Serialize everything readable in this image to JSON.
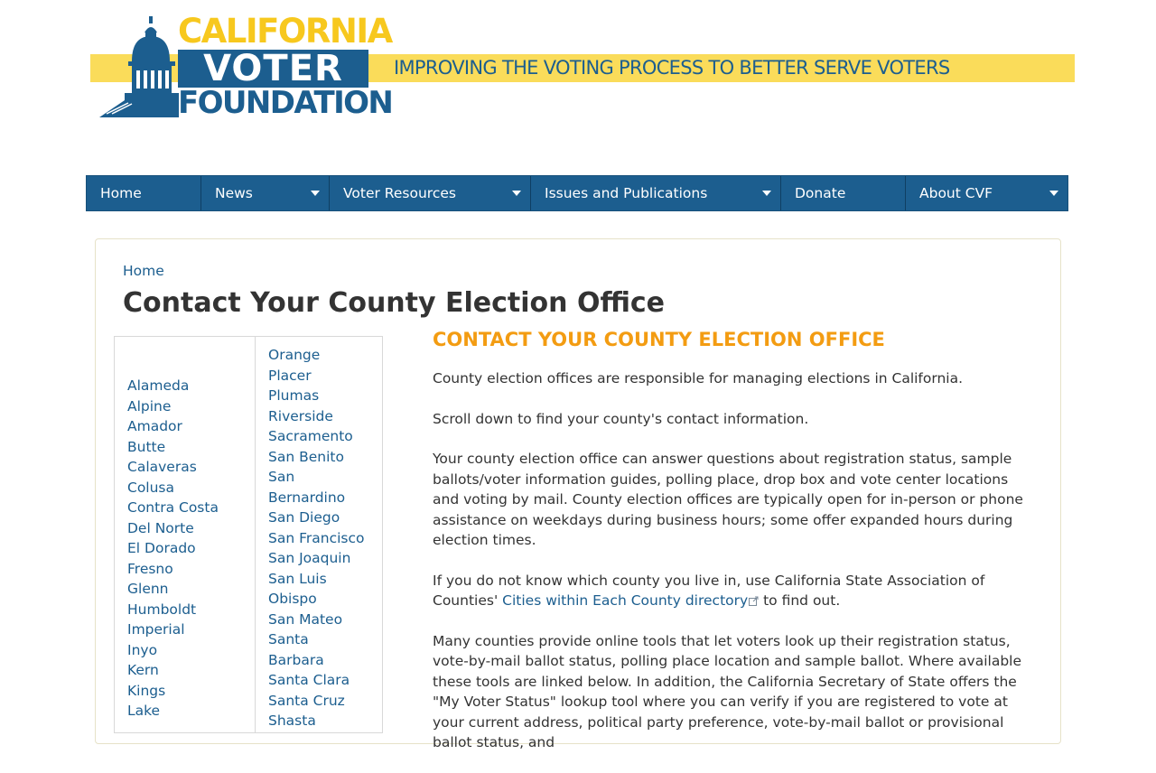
{
  "brand": {
    "line1": "CALIFORNIA",
    "line2": "VOTER",
    "line3": "FOUNDATION",
    "tagline": "IMPROVING THE VOTING PROCESS TO BETTER SERVE VOTERS",
    "colors": {
      "blue": "#1c5e8f",
      "yellow": "#f7c81e",
      "stripe": "#fadc5a"
    }
  },
  "nav": {
    "items": [
      {
        "label": "Home",
        "has_dropdown": false
      },
      {
        "label": "News",
        "has_dropdown": true
      },
      {
        "label": "Voter Resources",
        "has_dropdown": true
      },
      {
        "label": "Issues and Publications",
        "has_dropdown": true
      },
      {
        "label": "Donate",
        "has_dropdown": false
      },
      {
        "label": "About CVF",
        "has_dropdown": true
      }
    ]
  },
  "breadcrumb": {
    "home": "Home"
  },
  "page": {
    "title": "Contact Your County Election Office"
  },
  "counties": {
    "col_a": [
      "Alameda",
      "Alpine",
      "Amador",
      "Butte",
      "Calaveras",
      "Colusa",
      "Contra Costa",
      "Del Norte",
      "El Dorado",
      "Fresno",
      "Glenn",
      "Humboldt",
      "Imperial",
      "Inyo",
      "Kern",
      "Kings",
      "Lake"
    ],
    "col_b": [
      "Orange",
      "Placer",
      "Plumas",
      "Riverside",
      "Sacramento",
      "San Benito",
      "San",
      "Bernardino",
      "San Diego",
      "San Francisco",
      "San Joaquin",
      "San Luis",
      "Obispo",
      "San Mateo",
      "Santa",
      "Barbara",
      "Santa Clara",
      "Santa Cruz",
      "Shasta"
    ]
  },
  "content": {
    "heading": "CONTACT YOUR COUNTY ELECTION OFFICE",
    "p1": "County election offices are responsible for managing elections in California.",
    "p2": "Scroll down to find your county's contact information.",
    "p3": "Your county election office can answer questions about registration status, sample ballots/voter information guides, polling place, drop box and vote center locations and voting by mail. County election offices are typically open for in-person or phone assistance on weekdays during business hours; some offer expanded hours during election times.",
    "p4_before": "If you do not know which county you live in, use California State Association of Counties' ",
    "p4_link": "Cities within Each County directory",
    "p4_after": " to find out.",
    "p5": "Many counties provide online tools that let voters look up their registration status, vote-by-mail ballot status, polling place location and sample ballot. Where available these tools are linked below. In addition, the California Secretary of State offers the \"My Voter Status\" lookup tool where you can verify if you are registered to vote at your current address, political party preference, vote-by-mail ballot or provisional ballot status, and"
  },
  "icons": {
    "logo": "capitol-dome-icon",
    "caret": "caret-down-icon",
    "external": "external-link-icon"
  }
}
